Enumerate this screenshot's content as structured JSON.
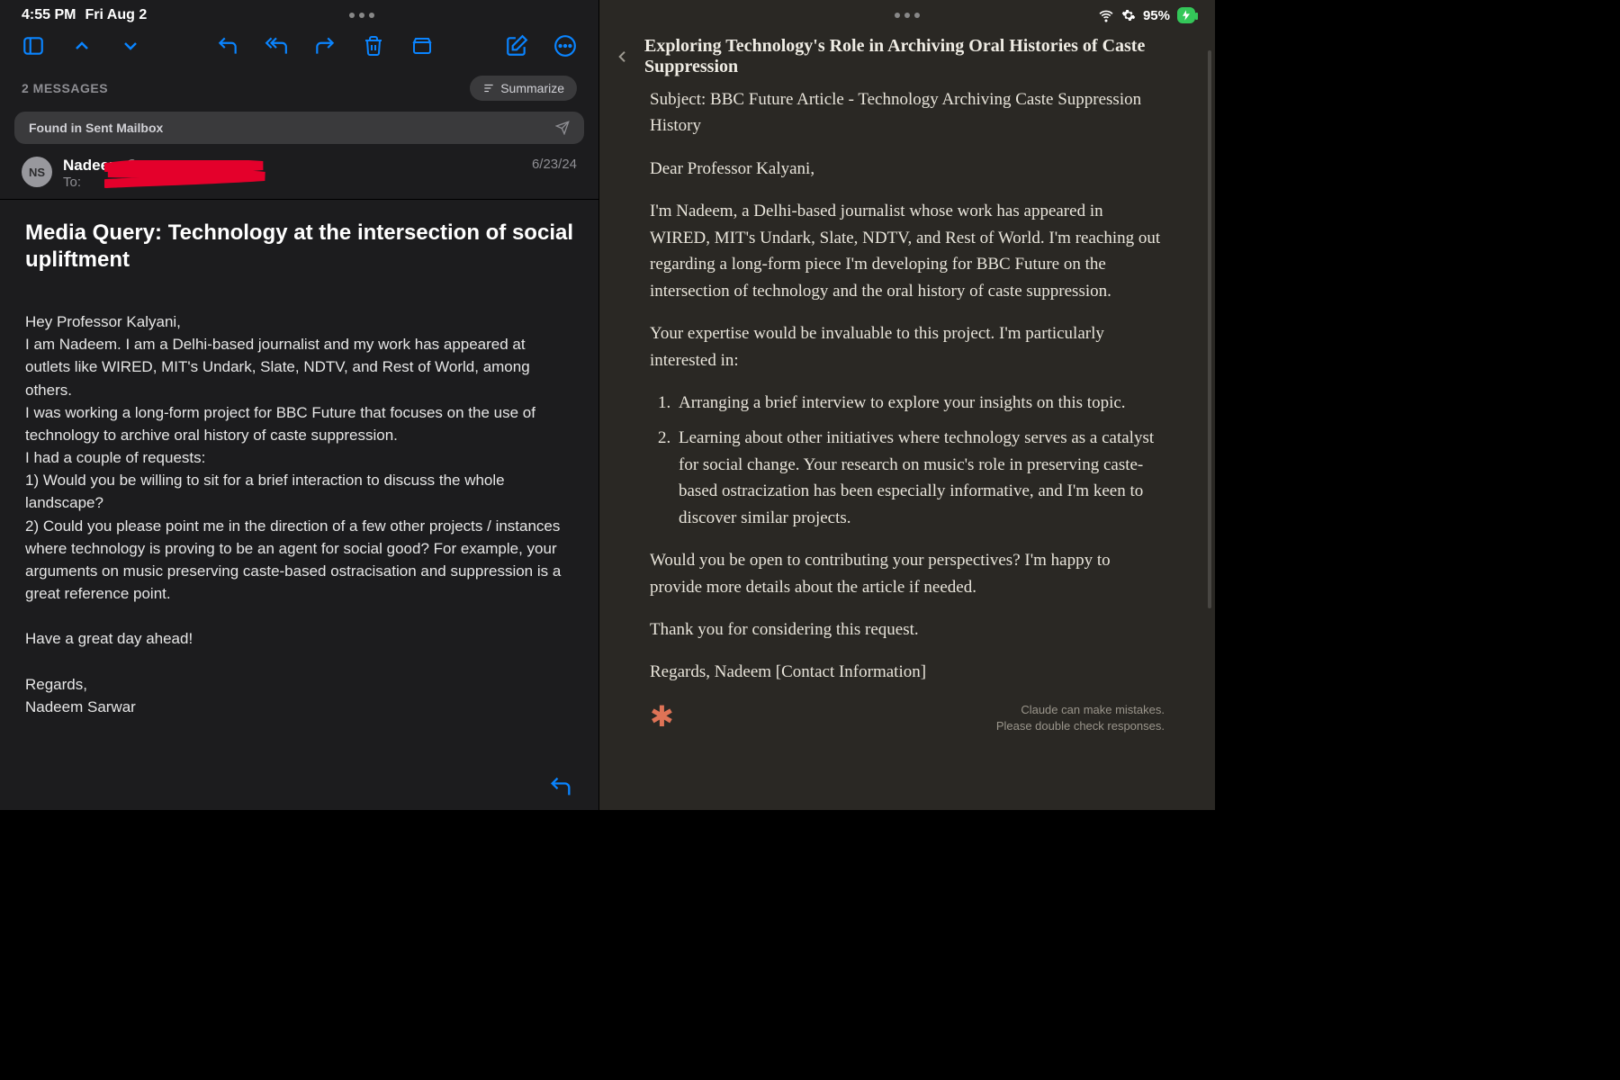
{
  "status": {
    "time": "4:55 PM",
    "date": "Fri Aug 2",
    "battery_pct": "95%"
  },
  "mail": {
    "messages_label": "2 MESSAGES",
    "summarize_label": "Summarize",
    "found_label": "Found in Sent Mailbox",
    "sender": {
      "initials": "NS",
      "name": "Nadeem Sarwar",
      "to_prefix": "To:",
      "date": "6/23/24"
    },
    "subject": "Media Query: Technology at the intersection of social upliftment",
    "body": {
      "greeting": "Hey Professor Kalyani,",
      "p1": "I am Nadeem. I am a Delhi-based journalist and my work has appeared at outlets like WIRED, MIT's Undark, Slate, NDTV, and Rest of World, among others.",
      "p2": "I was working a long-form project for BBC Future that focuses on the use of technology to archive oral history of caste suppression.",
      "p3": "I had a couple of requests:",
      "p4": "1) Would you be willing to sit for a brief interaction to discuss the whole landscape?",
      "p5": "2) Could you please point me in the direction of a few other projects / instances where technology is proving to be an agent for social good? For example, your arguments on music preserving caste-based ostracisation and suppression is a great reference point.",
      "p6": "Have a great day ahead!",
      "p7": "Regards,",
      "p8": "Nadeem Sarwar"
    }
  },
  "claude": {
    "title": "Exploring Technology's Role in Archiving Oral Histories of Caste Suppression",
    "subject": "Subject: BBC Future Article - Technology Archiving Caste Suppression History",
    "greeting": "Dear Professor Kalyani,",
    "p1": "I'm Nadeem, a Delhi-based journalist whose work has appeared in WIRED, MIT's Undark, Slate, NDTV, and Rest of World. I'm reaching out regarding a long-form piece I'm developing for BBC Future on the intersection of technology and the oral history of caste suppression.",
    "p2": "Your expertise would be invaluable to this project. I'm particularly interested in:",
    "li1": "Arranging a brief interview to explore your insights on this topic.",
    "li2": "Learning about other initiatives where technology serves as a catalyst for social change. Your research on music's role in preserving caste-based ostracization has been especially informative, and I'm keen to discover similar projects.",
    "p3": "Would you be open to contributing your perspectives? I'm happy to provide more details about the article if needed.",
    "p4": "Thank you for considering this request.",
    "p5": "Regards, Nadeem [Contact Information]",
    "disclaimer1": "Claude can make mistakes.",
    "disclaimer2": "Please double check responses."
  }
}
